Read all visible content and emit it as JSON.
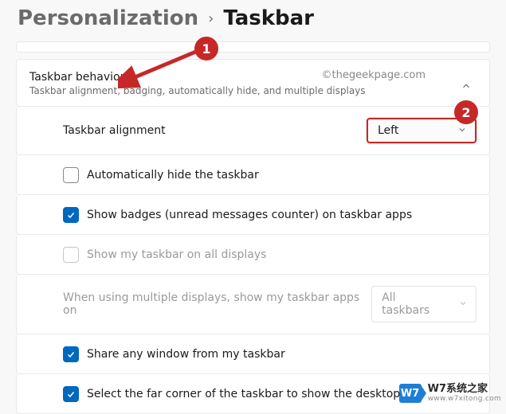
{
  "breadcrumb": {
    "parent": "Personalization",
    "current": "Taskbar"
  },
  "section": {
    "title": "Taskbar behaviors",
    "subtitle": "Taskbar alignment, badging, automatically hide, and multiple displays",
    "watermark": "©thegeekpage.com"
  },
  "rows": {
    "alignment": {
      "label": "Taskbar alignment",
      "value": "Left"
    },
    "autohide": {
      "label": "Automatically hide the taskbar",
      "checked": false
    },
    "badges": {
      "label": "Show badges (unread messages counter) on taskbar apps",
      "checked": true
    },
    "alldisplays": {
      "label": "Show my taskbar on all displays",
      "checked": false,
      "disabled": true
    },
    "multidisplay": {
      "label": "When using multiple displays, show my taskbar apps on",
      "value": "All taskbars",
      "disabled": true
    },
    "shareany": {
      "label": "Share any window from my taskbar",
      "checked": true
    },
    "farcorner": {
      "label": "Select the far corner of the taskbar to show the desktop",
      "checked": true
    }
  },
  "annotations": {
    "badge1": "1",
    "badge2": "2"
  },
  "bottom_watermark": {
    "logo": "W7",
    "line1": "W7系统之家",
    "line2": "www.w7xitong.com"
  }
}
